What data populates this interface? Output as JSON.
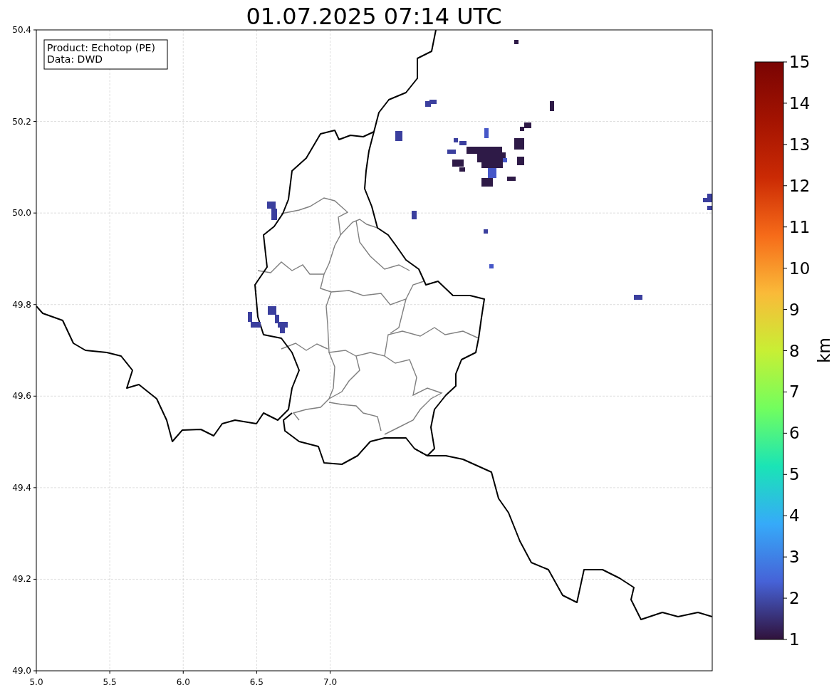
{
  "title": "01.07.2025 07:14 UTC",
  "info_box": {
    "lines": [
      "Product: Echotop (PE)",
      "Data: DWD"
    ]
  },
  "map": {
    "x_ticks": [
      "5.0",
      "5.5",
      "6.0",
      "6.5",
      "7.0"
    ],
    "y_ticks": [
      "50.4",
      "50.2",
      "50.0",
      "49.8",
      "49.6",
      "49.4",
      "49.2",
      "49.0"
    ]
  },
  "colorbar": {
    "label": "km",
    "ticks": [
      "15",
      "14",
      "13",
      "12",
      "11",
      "10",
      "9",
      "8",
      "7",
      "6",
      "5",
      "4",
      "3",
      "2",
      "1"
    ]
  }
}
